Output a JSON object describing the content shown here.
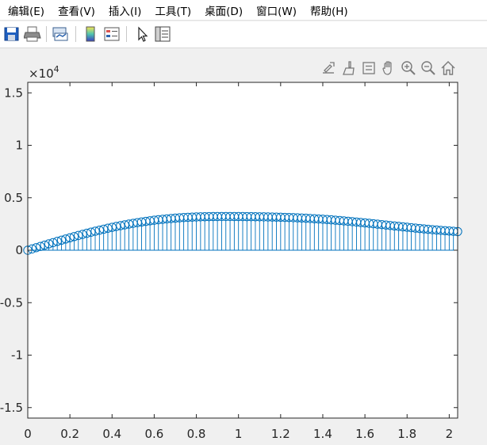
{
  "menu": {
    "items": [
      {
        "label": "编辑(E)"
      },
      {
        "label": "查看(V)"
      },
      {
        "label": "插入(I)"
      },
      {
        "label": "工具(T)"
      },
      {
        "label": "桌面(D)"
      },
      {
        "label": "窗口(W)"
      },
      {
        "label": "帮助(H)"
      }
    ]
  },
  "toolbar": {
    "buttons": [
      "save-icon",
      "print-icon",
      "link-plot-icon",
      "colorbar-icon",
      "legend-icon",
      "edit-plot-pointer-icon",
      "property-inspector-icon"
    ]
  },
  "axes_toolbar": {
    "buttons": [
      "export-icon",
      "brush-icon",
      "data-tips-icon",
      "pan-icon",
      "zoom-in-icon",
      "zoom-out-icon",
      "home-icon"
    ]
  },
  "colors": {
    "series": "#0072bd",
    "axis": "#262626",
    "background": "#f0f0f0",
    "plot_area": "#ffffff"
  },
  "chart_data": {
    "type": "stem",
    "marker": "circle",
    "exponent_base": "×10",
    "exponent_power": "4",
    "xlim": [
      0,
      2.04
    ],
    "ylim": [
      -16000,
      16000
    ],
    "xticks": [
      0,
      0.2,
      0.4,
      0.6,
      0.8,
      1,
      1.2,
      1.4,
      1.6,
      1.8,
      2
    ],
    "xtick_labels": [
      "0",
      "0.2",
      "0.4",
      "0.6",
      "0.8",
      "1",
      "1.2",
      "1.4",
      "1.6",
      "1.8",
      "2"
    ],
    "yticks": [
      -15000,
      -10000,
      -5000,
      0,
      5000,
      10000,
      15000
    ],
    "ytick_labels": [
      "-1.5",
      "-1",
      "-0.5",
      "0",
      "0.5",
      "1",
      "1.5"
    ],
    "grid": false,
    "series": [
      {
        "x": [
          0,
          0.02,
          0.04,
          0.06,
          0.08,
          0.1,
          0.12,
          0.14,
          0.16,
          0.18,
          0.2,
          0.22,
          0.24,
          0.26,
          0.28,
          0.3,
          0.32,
          0.34,
          0.36,
          0.38,
          0.4,
          0.42,
          0.44,
          0.46,
          0.48,
          0.5,
          0.52,
          0.54,
          0.56,
          0.58,
          0.6,
          0.62,
          0.64,
          0.66,
          0.68,
          0.7,
          0.72,
          0.74,
          0.76,
          0.78,
          0.8,
          0.82,
          0.84,
          0.86,
          0.88,
          0.9,
          0.92,
          0.94,
          0.96,
          0.98,
          1,
          1.02,
          1.04,
          1.06,
          1.08,
          1.1,
          1.12,
          1.14,
          1.16,
          1.18,
          1.2,
          1.22,
          1.24,
          1.26,
          1.28,
          1.3,
          1.32,
          1.34,
          1.36,
          1.38,
          1.4,
          1.42,
          1.44,
          1.46,
          1.48,
          1.5,
          1.52,
          1.54,
          1.56,
          1.58,
          1.6,
          1.62,
          1.64,
          1.66,
          1.68,
          1.7,
          1.72,
          1.74,
          1.76,
          1.78,
          1.8,
          1.82,
          1.84,
          1.86,
          1.88,
          1.9,
          1.92,
          1.94,
          1.96,
          1.98,
          2,
          2.02,
          2.04
        ],
        "y": [
          0,
          122,
          244,
          365,
          485,
          605,
          724,
          841,
          958,
          1072,
          1185,
          1296,
          1405,
          1511,
          1616,
          1717,
          1816,
          1912,
          2005,
          2095,
          2182,
          2265,
          2346,
          2422,
          2496,
          2565,
          2631,
          2693,
          2752,
          2807,
          2858,
          2905,
          2949,
          2989,
          3025,
          3058,
          3087,
          3113,
          3135,
          3154,
          3170,
          3184,
          3195,
          3203,
          3209,
          3213,
          3215,
          3216,
          3216,
          3214,
          3211,
          3207,
          3203,
          3198,
          3193,
          3187,
          3180,
          3172,
          3164,
          3154,
          3143,
          3131,
          3118,
          3103,
          3086,
          3068,
          3049,
          3027,
          3004,
          2980,
          2953,
          2925,
          2896,
          2864,
          2832,
          2797,
          2762,
          2725,
          2687,
          2648,
          2608,
          2567,
          2526,
          2484,
          2442,
          2400,
          2357,
          2315,
          2273,
          2231,
          2190,
          2149,
          2110,
          2071,
          2033,
          1996,
          1961,
          1927,
          1894,
          1863,
          1833,
          1805,
          1779
        ]
      }
    ]
  }
}
